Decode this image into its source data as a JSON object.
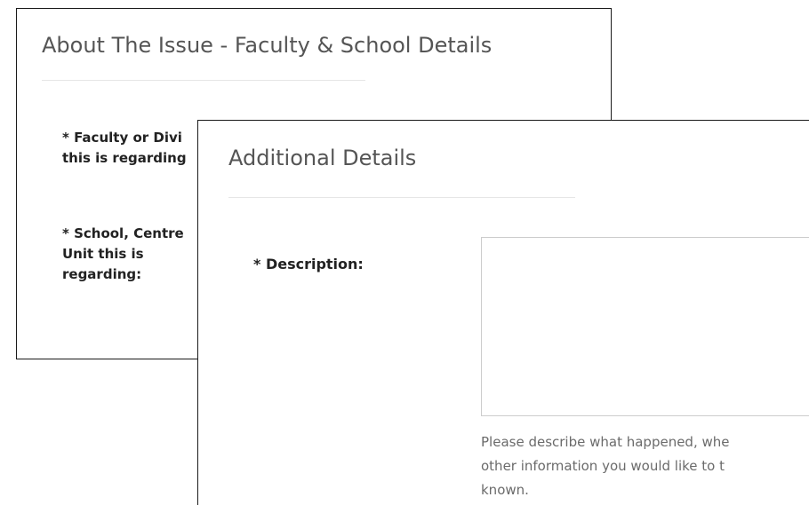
{
  "issue_panel": {
    "title": "About The Issue - Faculty & School Details",
    "faculty_label": [
      "* Faculty or Divi",
      "this is regarding"
    ],
    "school_label": [
      "* School, Centre",
      "Unit this is",
      "regarding:"
    ]
  },
  "details_panel": {
    "title": "Additional Details",
    "description_label": "* Description:",
    "description_value": "",
    "help_text": [
      "Please describe what happened, whe",
      "other information you would like to t",
      "known."
    ]
  }
}
